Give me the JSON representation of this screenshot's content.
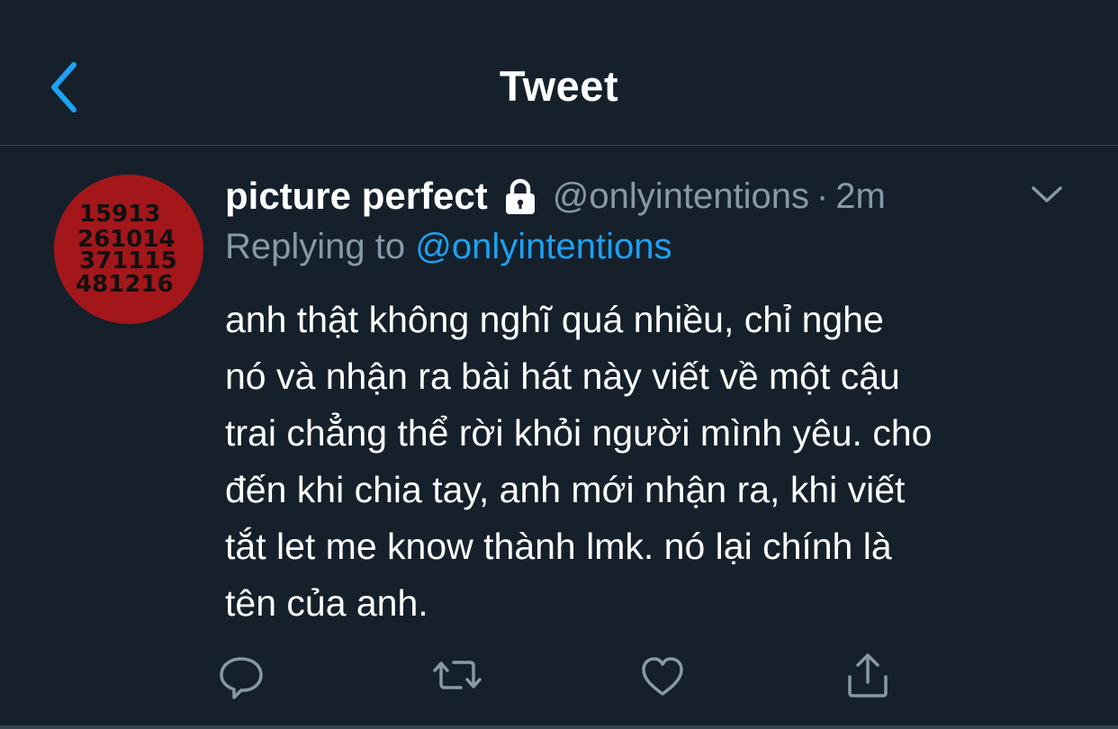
{
  "header": {
    "title": "Tweet",
    "back_icon": "chevron-left-icon"
  },
  "tweet": {
    "avatar_text": [
      "15913",
      "261014",
      "371115",
      "481216"
    ],
    "display_name": "picture perfect",
    "protected_icon": "lock-icon",
    "handle": "@onlyintentions",
    "separator": "·",
    "time": "2m",
    "replying_prefix": "Replying to",
    "replying_to": "@onlyintentions",
    "body_lines": [
      "anh thật không nghĩ quá nhiều, chỉ nghe",
      "nó và nhận ra bài hát này viết về một cậu",
      "trai chẳng thể rời khỏi người mình yêu. cho",
      "đến khi chia tay, anh mới nhận ra, khi viết",
      "tắt let me know thành lmk. nó lại chính là",
      "tên của anh."
    ]
  },
  "actions": {
    "reply": "reply-icon",
    "retweet": "retweet-icon",
    "like": "heart-icon",
    "share": "share-icon"
  },
  "colors": {
    "background": "#15202b",
    "divider": "#38444d",
    "secondary_text": "#8899a6",
    "accent": "#1da1f2",
    "avatar_bg": "#a3171b"
  }
}
